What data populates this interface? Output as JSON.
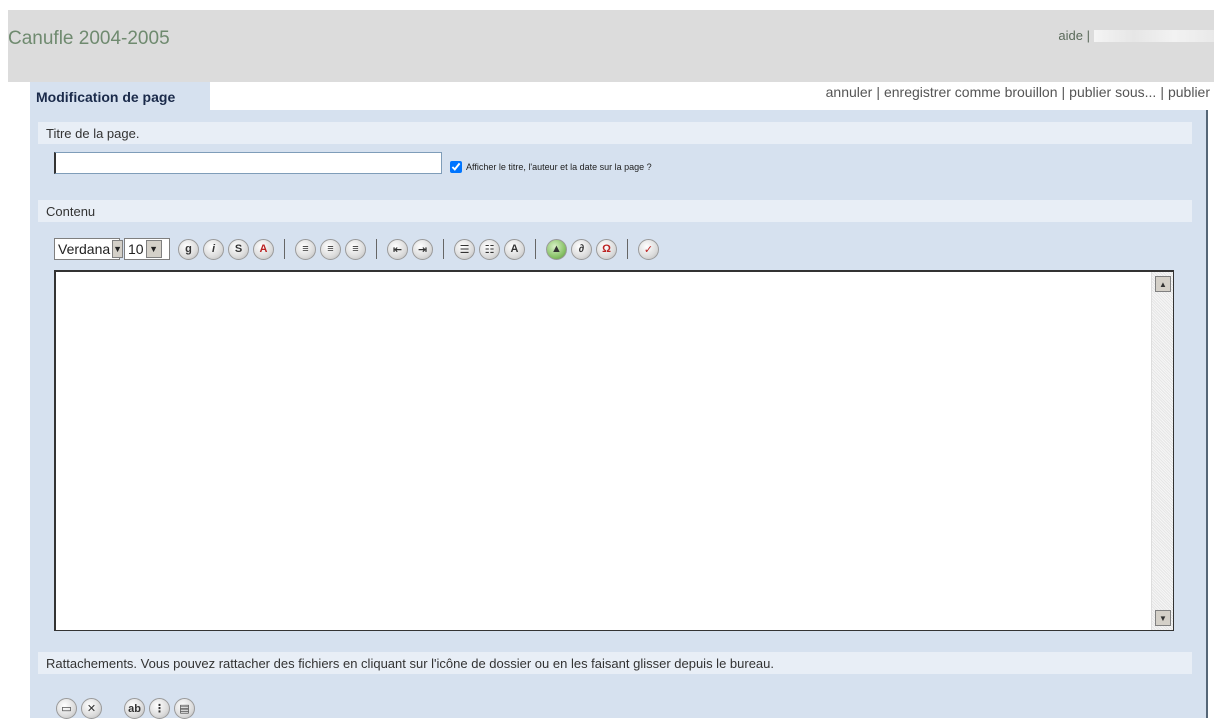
{
  "header": {
    "site_title": "Canufle 2004-2005",
    "help_link": "aide |"
  },
  "tab": {
    "label": "Modification de page"
  },
  "actions": {
    "cancel": "annuler",
    "save_draft": "enregistrer comme brouillon",
    "publish_as": "publier sous...",
    "publish": "publier"
  },
  "title_section": {
    "label": "Titre de la page.",
    "input_value": "",
    "show_meta_label": "Afficher le titre, l'auteur et la date sur la page ?",
    "show_meta_checked": true
  },
  "content_section": {
    "label": "Contenu"
  },
  "toolbar": {
    "font": "Verdana",
    "size": "10",
    "buttons": [
      "bold-icon",
      "italic-icon",
      "strikethrough-icon",
      "font-color-icon",
      "align-left-icon",
      "align-center-icon",
      "align-right-icon",
      "outdent-icon",
      "indent-icon",
      "bulleted-list-icon",
      "numbered-list-icon",
      "font-size-icon",
      "insert-image-icon",
      "attach-link-icon",
      "special-character-icon",
      "spellcheck-icon"
    ]
  },
  "attachments_section": {
    "label": "Rattachements. Vous pouvez rattacher des fichiers en cliquant sur l'icône de dossier ou en les faisant glisser depuis le bureau."
  },
  "colors": {
    "panel_bg": "#d6e1ef",
    "topbar_bg": "#dcdcdc",
    "title_color": "#6f8a6f"
  }
}
